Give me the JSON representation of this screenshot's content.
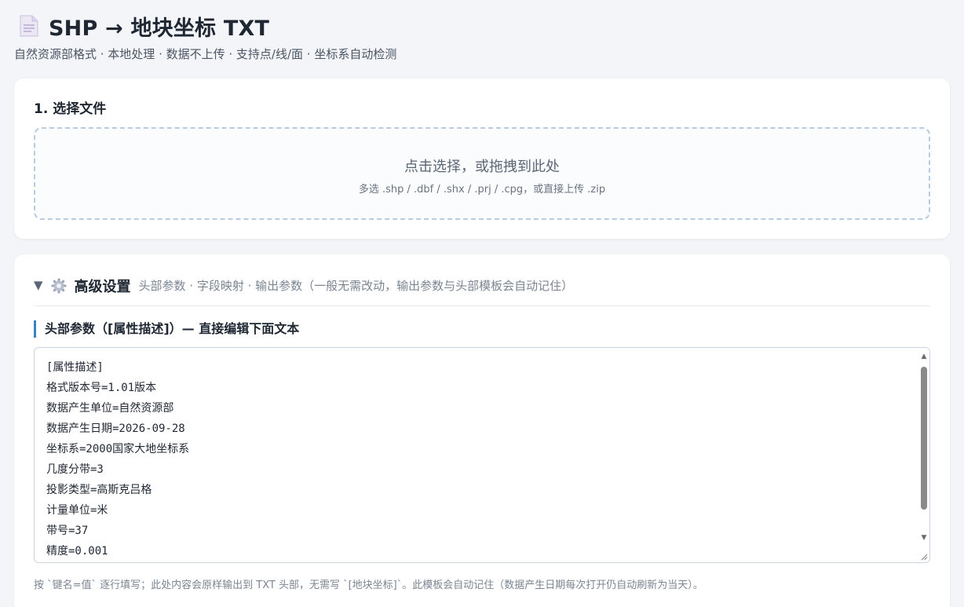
{
  "header": {
    "title": "SHP → 地块坐标 TXT",
    "subtitle": "自然资源部格式 · 本地处理 · 数据不上传 · 支持点/线/面 · 坐标系自动检测",
    "icon": "document-icon"
  },
  "file_section": {
    "title": "1. 选择文件",
    "dropzone_main": "点击选择，或拖拽到此处",
    "dropzone_sub": "多选 .shp / .dbf / .shx / .prj / .cpg，或直接上传 .zip"
  },
  "advanced": {
    "toggle_icon": "▼",
    "gear_icon": "gear-icon",
    "title": "高级设置",
    "description": "头部参数 · 字段映射 · 输出参数（一般无需改动，输出参数与头部模板会自动记住）",
    "header_params_title": "头部参数（[属性描述]）— 直接编辑下面文本",
    "header_text": "[属性描述]\n格式版本号=1.01版本\n数据产生单位=自然资源部\n数据产生日期=2026-09-28\n坐标系=2000国家大地坐标系\n几度分带=3\n投影类型=高斯克吕格\n计量单位=米\n带号=37\n精度=0.001",
    "hint": "按 `键名=值` 逐行填写；此处内容会原样输出到 TXT 头部，无需写 `[地块坐标]`。此模板会自动记住（数据产生日期每次打开仍自动刷新为当天）。"
  },
  "colors": {
    "accent": "#3b82c4",
    "background": "#f3f5f8",
    "dropzone_border": "#b9cbe0"
  }
}
